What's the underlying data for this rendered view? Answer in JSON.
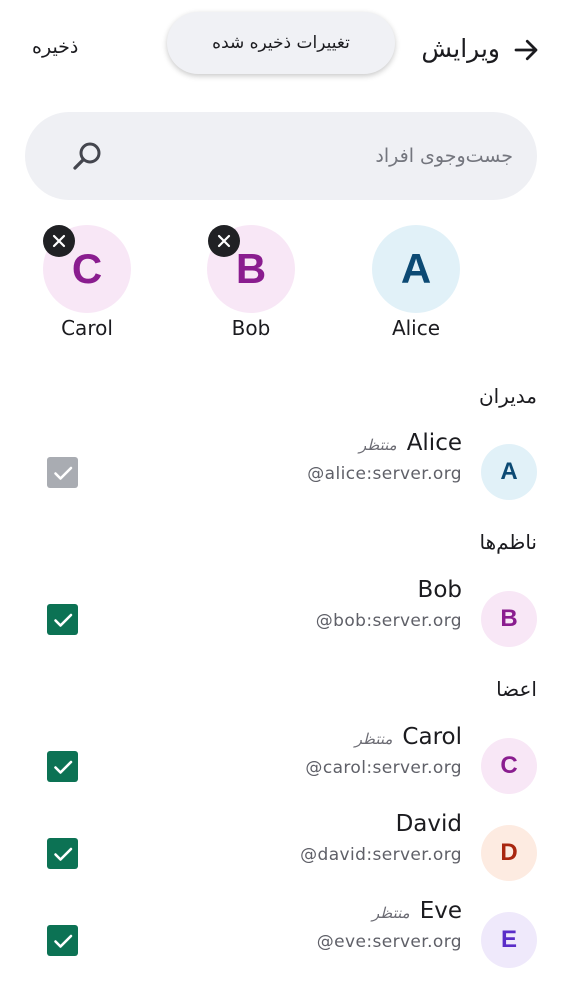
{
  "header": {
    "title": "ویرایش",
    "save_label": "ذخیره",
    "toast": "تغییرات ذخیره شده"
  },
  "search": {
    "placeholder": "جست‌وجوی افراد"
  },
  "selected": [
    {
      "initial": "A",
      "name": "Alice",
      "removable": false,
      "bg": "#e1f1f8",
      "fg": "#0c4a74"
    },
    {
      "initial": "B",
      "name": "Bob",
      "removable": true,
      "bg": "#f8e7f6",
      "fg": "#8a1d8f"
    },
    {
      "initial": "C",
      "name": "Carol",
      "removable": true,
      "bg": "#f8e7f6",
      "fg": "#8a1d8f"
    }
  ],
  "sections": {
    "admins": "مدیران",
    "moderators": "ناظم‌ها",
    "members": "اعضا"
  },
  "people": {
    "alice": {
      "initial": "A",
      "name": "Alice",
      "pending": "منتظر",
      "handle": "@alice:server.org",
      "checked": true,
      "disabled": true,
      "bg": "#e1f1f8",
      "fg": "#0c4a74"
    },
    "bob": {
      "initial": "B",
      "name": "Bob",
      "pending": "",
      "handle": "@bob:server.org",
      "checked": true,
      "disabled": false,
      "bg": "#f8e7f6",
      "fg": "#8a1d8f"
    },
    "carol": {
      "initial": "C",
      "name": "Carol",
      "pending": "منتظر",
      "handle": "@carol:server.org",
      "checked": true,
      "disabled": false,
      "bg": "#f8e7f6",
      "fg": "#8a1d8f"
    },
    "david": {
      "initial": "D",
      "name": "David",
      "pending": "",
      "handle": "@david:server.org",
      "checked": true,
      "disabled": false,
      "bg": "#fdebe1",
      "fg": "#a9260f"
    },
    "eve": {
      "initial": "E",
      "name": "Eve",
      "pending": "منتظر",
      "handle": "@eve:server.org",
      "checked": true,
      "disabled": false,
      "bg": "#efe9fb",
      "fg": "#5a2dc8"
    }
  },
  "colors": {
    "checkbox_on": "#0c7254",
    "checkbox_disabled": "#a9acb2",
    "search_bg": "#eff0f4"
  }
}
